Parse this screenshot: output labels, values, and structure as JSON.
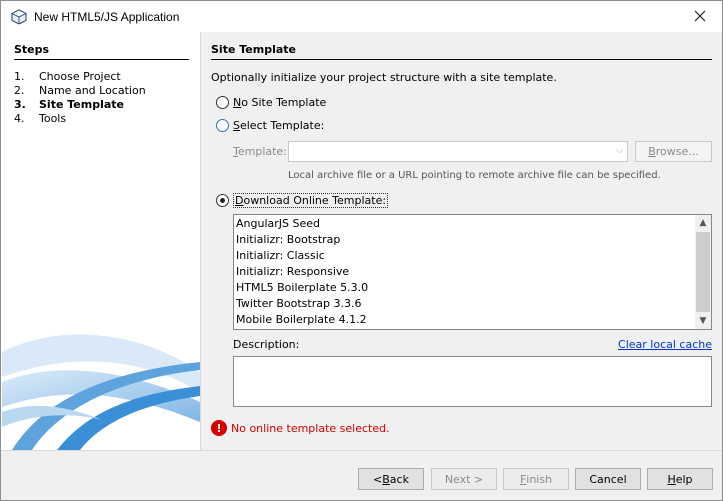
{
  "window": {
    "title": "New HTML5/JS Application",
    "icon": "cube-icon",
    "close_icon": "close-icon"
  },
  "steps": {
    "title": "Steps",
    "items": [
      {
        "num": "1.",
        "label": "Choose Project"
      },
      {
        "num": "2.",
        "label": "Name and Location"
      },
      {
        "num": "3.",
        "label": "Site Template"
      },
      {
        "num": "4.",
        "label": "Tools"
      }
    ],
    "current_index": 2
  },
  "content": {
    "title": "Site Template",
    "intro": "Optionally initialize your project structure with a site template.",
    "options": {
      "no_template": {
        "mnemonic": "N",
        "rest": "o Site Template",
        "selected": false
      },
      "select_template": {
        "mnemonic": "S",
        "rest": "elect Template:",
        "selected": false
      },
      "download_online": {
        "mnemonic": "D",
        "rest": "ownload Online Template:",
        "selected": true
      }
    },
    "template_field": {
      "label_mnemonic": "T",
      "label_rest": "emplate:",
      "value": "",
      "browse_mnemonic": "B",
      "browse_rest": "rowse..."
    },
    "hint": "Local archive file or a URL pointing to remote archive file can be specified.",
    "online_templates": [
      "AngularJS Seed",
      "Initializr: Bootstrap",
      "Initializr: Classic",
      "Initializr: Responsive",
      "HTML5 Boilerplate 5.3.0",
      "Twitter Bootstrap 3.3.6",
      "Mobile Boilerplate 4.1.2"
    ],
    "description_label": "Description:",
    "description_value": "",
    "clear_cache_link": "Clear local cache",
    "error": "No online template selected."
  },
  "buttons": {
    "back": {
      "pre": "< ",
      "mnemonic": "B",
      "rest": "ack",
      "enabled": true
    },
    "next": {
      "label": "Next >",
      "enabled": false
    },
    "finish": {
      "mnemonic": "F",
      "rest": "inish",
      "enabled": false
    },
    "cancel": {
      "label": "Cancel",
      "enabled": true
    },
    "help": {
      "mnemonic": "H",
      "rest": "elp",
      "enabled": true
    }
  },
  "colors": {
    "content_bg": "#f0f0f0",
    "link": "#0033cc",
    "error": "#d40000",
    "swoosh": "#3a8fd6"
  }
}
